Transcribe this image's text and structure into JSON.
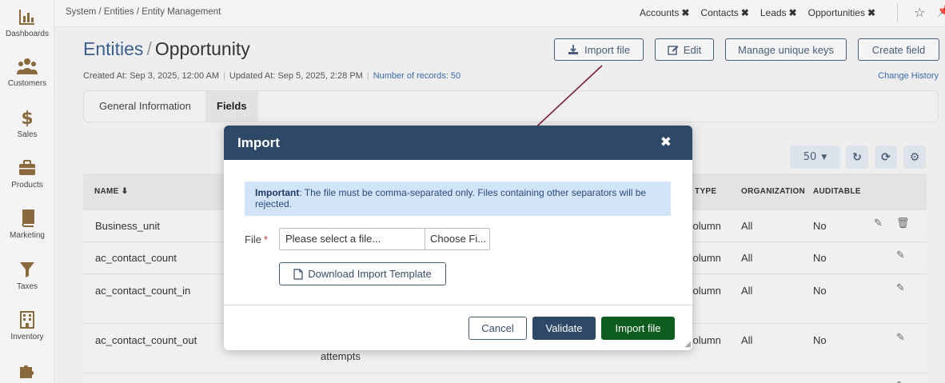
{
  "sidebar": {
    "items": [
      {
        "label": "Dashboards",
        "icon": "bar-chart-icon"
      },
      {
        "label": "Customers",
        "icon": "users-icon"
      },
      {
        "label": "Sales",
        "icon": "dollar-icon"
      },
      {
        "label": "Products",
        "icon": "briefcase-icon"
      },
      {
        "label": "Marketing",
        "icon": "book-icon"
      },
      {
        "label": "Taxes",
        "icon": "funnel-icon"
      },
      {
        "label": "Inventory",
        "icon": "building-icon"
      },
      {
        "label": "",
        "icon": "puzzle-icon"
      }
    ]
  },
  "topbar": {
    "breadcrumb": "System / Entities / Entity Management",
    "tabs": [
      {
        "label": "Accounts",
        "close": "✖"
      },
      {
        "label": "Contacts",
        "close": "✖"
      },
      {
        "label": "Leads",
        "close": "✖"
      },
      {
        "label": "Opportunities",
        "close": "✖"
      }
    ]
  },
  "header": {
    "title_parent": "Entities",
    "title_sep": "/",
    "title_entity": "Opportunity",
    "created": "Created At: Sep 3, 2025, 12:00 AM",
    "updated": "Updated At: Sep 5, 2025, 2:28 PM",
    "records": "Number of records: 50",
    "change_history": "Change History",
    "buttons": {
      "import": "Import file",
      "edit": "Edit",
      "unique_keys": "Manage unique keys",
      "create_field": "Create field"
    }
  },
  "tabs": {
    "general": "General Information",
    "fields": "Fields"
  },
  "toolbar": {
    "per_page": "50"
  },
  "table": {
    "headers": {
      "name": "NAME",
      "type": "E TYPE",
      "organization": "ORGANIZATION",
      "auditable": "AUDITABLE"
    },
    "rows": [
      {
        "name": "Business_unit",
        "type": "column",
        "org": "All",
        "auditable": "No",
        "extra": ""
      },
      {
        "name": "ac_contact_count",
        "type": "column",
        "org": "All",
        "auditable": "No",
        "extra": ""
      },
      {
        "name": "ac_contact_count_in",
        "type": "column",
        "org": "All",
        "auditable": "No",
        "extra": ""
      },
      {
        "name": "ac_contact_count_out",
        "type": "column",
        "org": "All",
        "auditable": "No",
        "extra": "attempts"
      }
    ]
  },
  "modal": {
    "title": "Import",
    "close": "✖",
    "alert_strong": "Important",
    "alert_text": ": The file must be comma-separated only. Files containing other separators will be rejected.",
    "file_label": "File",
    "required_mark": "*",
    "file_placeholder": "Please select a file...",
    "choose_label": "Choose Fi...",
    "download_label": "Download Import Template",
    "cancel": "Cancel",
    "validate": "Validate",
    "import": "Import file"
  },
  "colors": {
    "primary": "#2e4868",
    "success": "#0e5c1e",
    "link": "#3a6aa8",
    "arrow": "#7a1f3a"
  }
}
